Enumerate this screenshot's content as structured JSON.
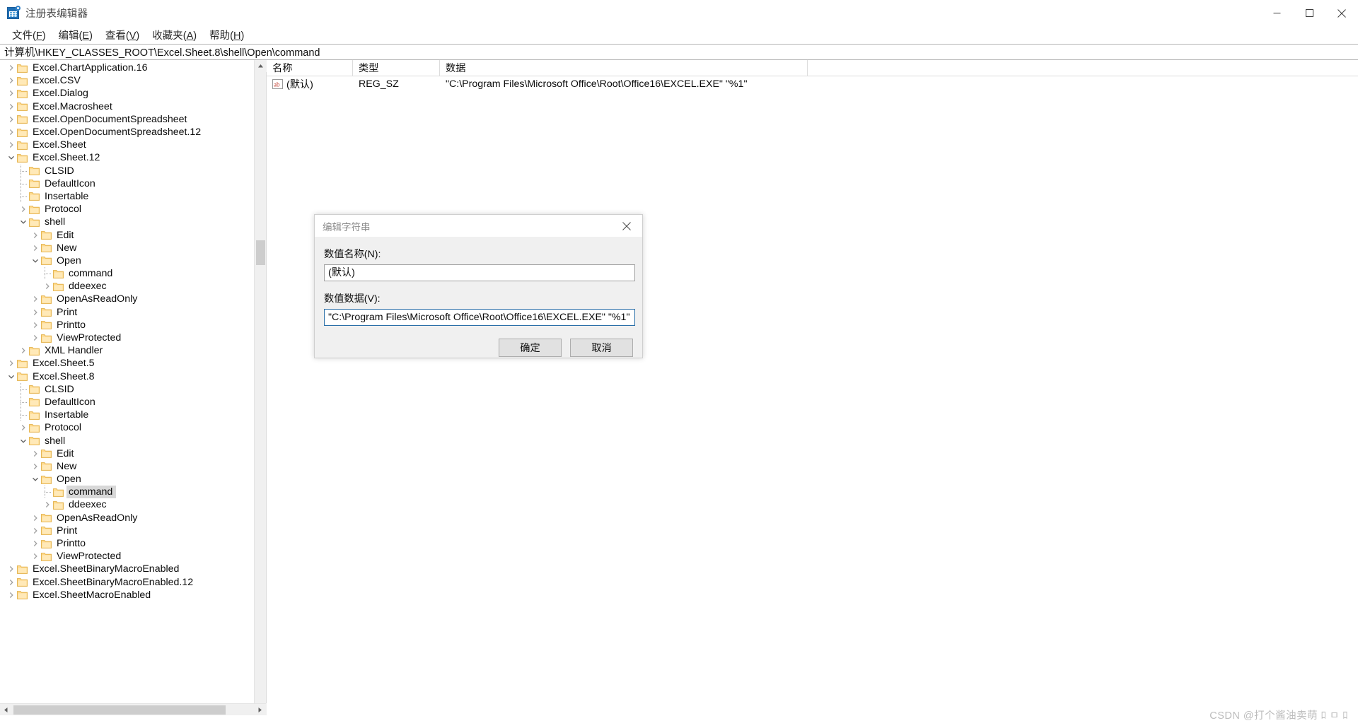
{
  "window": {
    "title": "注册表编辑器",
    "icon": "registry-editor-icon",
    "controls": {
      "minimize": "minimize-icon",
      "maximize": "maximize-icon",
      "close": "close-icon"
    }
  },
  "menubar": {
    "items": [
      {
        "label": "文件(F)",
        "text": "文件",
        "accel": "F"
      },
      {
        "label": "编辑(E)",
        "text": "编辑",
        "accel": "E"
      },
      {
        "label": "查看(V)",
        "text": "查看",
        "accel": "V"
      },
      {
        "label": "收藏夹(A)",
        "text": "收藏夹",
        "accel": "A"
      },
      {
        "label": "帮助(H)",
        "text": "帮助",
        "accel": "H"
      }
    ]
  },
  "address": {
    "path": "计算机\\HKEY_CLASSES_ROOT\\Excel.Sheet.8\\shell\\Open\\command"
  },
  "tree": {
    "items": [
      {
        "label": "Excel.ChartApplication.16",
        "depth": 1,
        "state": "collapsed"
      },
      {
        "label": "Excel.CSV",
        "depth": 1,
        "state": "collapsed"
      },
      {
        "label": "Excel.Dialog",
        "depth": 1,
        "state": "collapsed"
      },
      {
        "label": "Excel.Macrosheet",
        "depth": 1,
        "state": "collapsed"
      },
      {
        "label": "Excel.OpenDocumentSpreadsheet",
        "depth": 1,
        "state": "collapsed"
      },
      {
        "label": "Excel.OpenDocumentSpreadsheet.12",
        "depth": 1,
        "state": "collapsed"
      },
      {
        "label": "Excel.Sheet",
        "depth": 1,
        "state": "collapsed"
      },
      {
        "label": "Excel.Sheet.12",
        "depth": 1,
        "state": "expanded"
      },
      {
        "label": "CLSID",
        "depth": 2,
        "state": "leaf"
      },
      {
        "label": "DefaultIcon",
        "depth": 2,
        "state": "leaf"
      },
      {
        "label": "Insertable",
        "depth": 2,
        "state": "leaf"
      },
      {
        "label": "Protocol",
        "depth": 2,
        "state": "collapsed"
      },
      {
        "label": "shell",
        "depth": 2,
        "state": "expanded"
      },
      {
        "label": "Edit",
        "depth": 3,
        "state": "collapsed"
      },
      {
        "label": "New",
        "depth": 3,
        "state": "collapsed"
      },
      {
        "label": "Open",
        "depth": 3,
        "state": "expanded"
      },
      {
        "label": "command",
        "depth": 4,
        "state": "leaf"
      },
      {
        "label": "ddeexec",
        "depth": 4,
        "state": "collapsed"
      },
      {
        "label": "OpenAsReadOnly",
        "depth": 3,
        "state": "collapsed"
      },
      {
        "label": "Print",
        "depth": 3,
        "state": "collapsed"
      },
      {
        "label": "Printto",
        "depth": 3,
        "state": "collapsed"
      },
      {
        "label": "ViewProtected",
        "depth": 3,
        "state": "collapsed"
      },
      {
        "label": "XML Handler",
        "depth": 2,
        "state": "collapsed"
      },
      {
        "label": "Excel.Sheet.5",
        "depth": 1,
        "state": "collapsed"
      },
      {
        "label": "Excel.Sheet.8",
        "depth": 1,
        "state": "expanded"
      },
      {
        "label": "CLSID",
        "depth": 2,
        "state": "leaf"
      },
      {
        "label": "DefaultIcon",
        "depth": 2,
        "state": "leaf"
      },
      {
        "label": "Insertable",
        "depth": 2,
        "state": "leaf"
      },
      {
        "label": "Protocol",
        "depth": 2,
        "state": "collapsed"
      },
      {
        "label": "shell",
        "depth": 2,
        "state": "expanded"
      },
      {
        "label": "Edit",
        "depth": 3,
        "state": "collapsed"
      },
      {
        "label": "New",
        "depth": 3,
        "state": "collapsed"
      },
      {
        "label": "Open",
        "depth": 3,
        "state": "expanded"
      },
      {
        "label": "command",
        "depth": 4,
        "state": "leaf",
        "selected": true
      },
      {
        "label": "ddeexec",
        "depth": 4,
        "state": "collapsed"
      },
      {
        "label": "OpenAsReadOnly",
        "depth": 3,
        "state": "collapsed"
      },
      {
        "label": "Print",
        "depth": 3,
        "state": "collapsed"
      },
      {
        "label": "Printto",
        "depth": 3,
        "state": "collapsed"
      },
      {
        "label": "ViewProtected",
        "depth": 3,
        "state": "collapsed"
      },
      {
        "label": "Excel.SheetBinaryMacroEnabled",
        "depth": 1,
        "state": "collapsed"
      },
      {
        "label": "Excel.SheetBinaryMacroEnabled.12",
        "depth": 1,
        "state": "collapsed"
      },
      {
        "label": "Excel.SheetMacroEnabled",
        "depth": 1,
        "state": "collapsed"
      }
    ]
  },
  "list": {
    "columns": [
      "名称",
      "类型",
      "数据"
    ],
    "rows": [
      {
        "icon": "string-value-icon",
        "name": "(默认)",
        "type": "REG_SZ",
        "data": "\"C:\\Program Files\\Microsoft Office\\Root\\Office16\\EXCEL.EXE\" \"%1\""
      }
    ]
  },
  "dialog": {
    "title": "编辑字符串",
    "close_icon": "close-icon",
    "name_label": "数值名称(N):",
    "name_value": "(默认)",
    "data_label": "数值数据(V):",
    "data_value": "\"C:\\Program Files\\Microsoft Office\\Root\\Office16\\EXCEL.EXE\" \"%1\"",
    "ok_button": "确定",
    "cancel_button": "取消"
  },
  "watermark": {
    "text": "CSDN @打个酱油卖萌 ﾛ ㅁ ﾛ"
  },
  "colors": {
    "selection": "#d8d8d8",
    "focus_border": "#2a6fa8",
    "folder": "#ffd27f",
    "dialog_bg": "#f0f0f0"
  }
}
